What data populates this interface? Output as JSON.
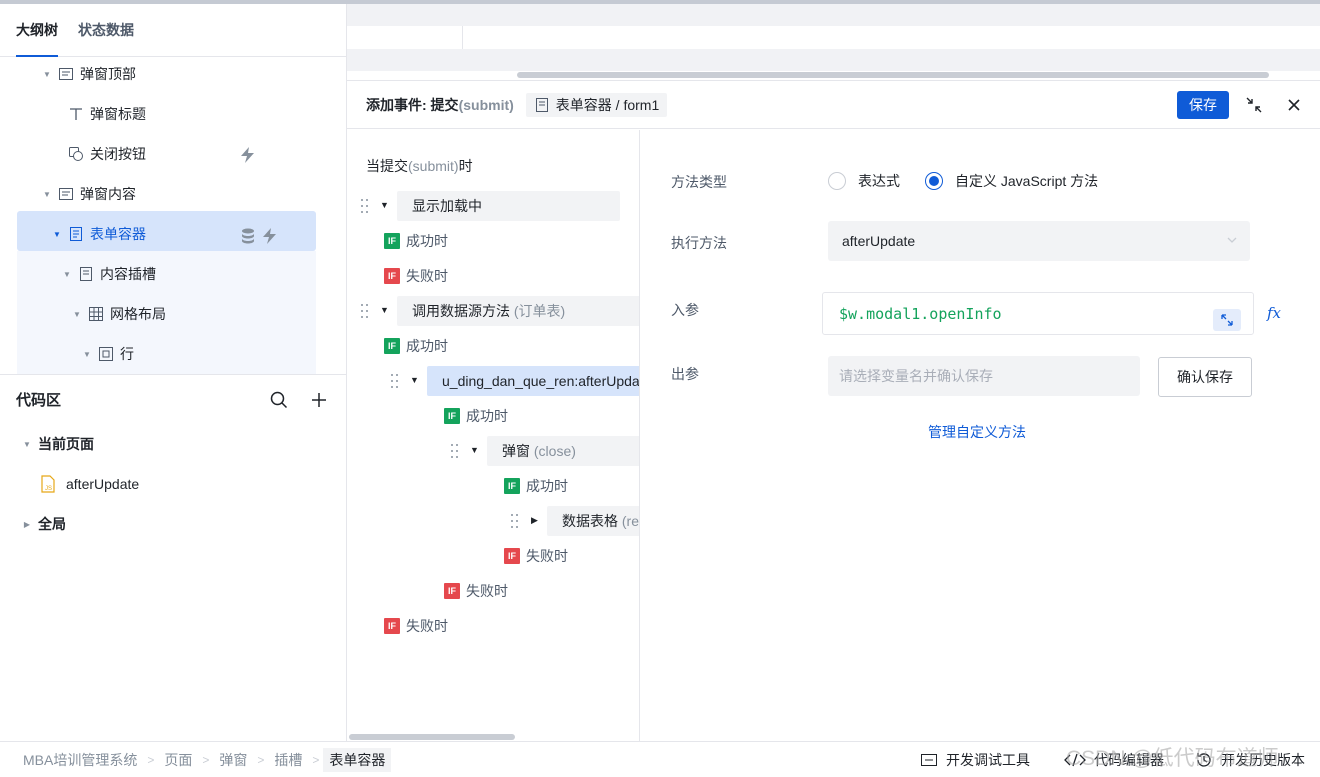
{
  "left_tabs": [
    "大纲树",
    "状态数据"
  ],
  "outline": {
    "items": [
      {
        "label": "弹窗顶部"
      },
      {
        "label": "弹窗标题"
      },
      {
        "label": "关闭按钮"
      },
      {
        "label": "弹窗内容"
      },
      {
        "label": "表单容器"
      },
      {
        "label": "内容插槽"
      },
      {
        "label": "网格布局"
      },
      {
        "label": "行"
      }
    ]
  },
  "code_area": {
    "title": "代码区",
    "current_page_label": "当前页面",
    "file_name": "afterUpdate",
    "global_label": "全局"
  },
  "event_panel": {
    "title": "添加事件: 提交",
    "title_sub": "(submit)",
    "target": "表单容器 / form1",
    "save_label": "保存"
  },
  "flow": {
    "trigger_prefix": "当提交",
    "trigger_sub": "(submit)",
    "trigger_suffix": "时",
    "success": "成功时",
    "fail": "失败时",
    "if_badge": "IF",
    "action_loading": "显示加载中",
    "action_datasource": "调用数据源方法",
    "action_datasource_sub": "(订单表)",
    "action_custom": "u_ding_dan_que_ren:afterUpdate",
    "action_modal": "弹窗",
    "action_modal_sub": "(close)",
    "action_table": "数据表格",
    "action_table_sub": "(refresh)"
  },
  "form": {
    "method_type_label": "方法类型",
    "radio_expression": "表达式",
    "radio_custom": "自定义 JavaScript 方法",
    "selected_method_type": "自定义 JavaScript 方法",
    "exec_method_label": "执行方法",
    "exec_method_value": "afterUpdate",
    "input_param_label": "入参",
    "input_param_value": "$w.modal1.openInfo",
    "fx_label": "fx",
    "output_param_label": "出参",
    "output_placeholder": "请选择变量名并确认保存",
    "confirm_label": "确认保存",
    "manage_link": "管理自定义方法"
  },
  "breadcrumb": [
    "MBA培训管理系统",
    "页面",
    "弹窗",
    "插槽",
    "表单容器"
  ],
  "status_tools": {
    "devtools": "开发调试工具",
    "code_editor": "代码编辑器",
    "history": "开发历史版本"
  },
  "watermark": "CSDN @低代码布道师",
  "colors": {
    "primary": "#0f5bd7",
    "success_badge": "#14a35c",
    "fail_badge": "#e5484d",
    "selected_bg": "#d6e4fb"
  }
}
